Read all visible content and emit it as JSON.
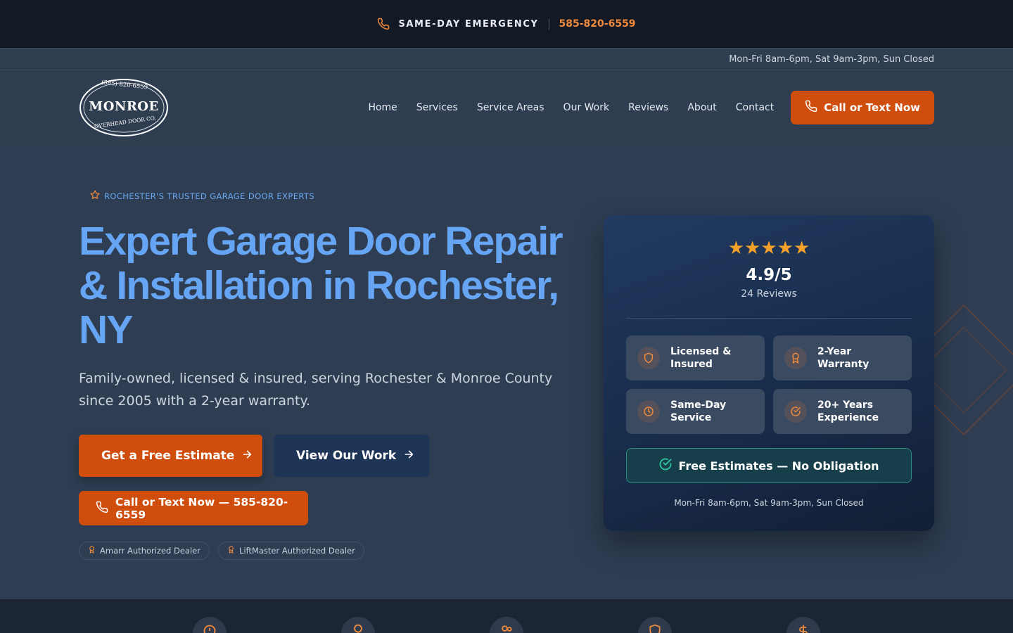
{
  "topbar": {
    "emergency_label": "SAME-DAY EMERGENCY",
    "phone": "585-820-6559"
  },
  "hours_bar": {
    "text": "Mon-Fri 8am-6pm, Sat 9am-3pm, Sun Closed"
  },
  "logo": {
    "phone": "(585) 820-6559",
    "name": "MONROE",
    "subtitle": "OVERHEAD DOOR CO."
  },
  "nav": {
    "items": [
      {
        "label": "Home"
      },
      {
        "label": "Services"
      },
      {
        "label": "Service Areas"
      },
      {
        "label": "Our Work"
      },
      {
        "label": "Reviews"
      },
      {
        "label": "About"
      },
      {
        "label": "Contact"
      }
    ],
    "cta_label": "Call or Text Now"
  },
  "hero": {
    "eyebrow": "ROCHESTER'S TRUSTED GARAGE DOOR EXPERTS",
    "headline": "Expert Garage Door Repair & Installation in Rochester, NY",
    "lead": "Family-owned, licensed & insured, serving Rochester & Monroe County since 2005 with a 2-year warranty.",
    "btn_estimate": "Get a Free Estimate",
    "btn_work": "View Our Work",
    "btn_call": "Call or Text Now — 585-820-6559",
    "dealers": [
      "Amarr Authorized Dealer",
      "LiftMaster Authorized Dealer"
    ]
  },
  "card": {
    "stars": "★★★★★",
    "rating": "4.9/5",
    "review_count": "24 Reviews",
    "features": [
      {
        "label": "Licensed & Insured",
        "icon": "shield-icon"
      },
      {
        "label": "2-Year Warranty",
        "icon": "award-icon"
      },
      {
        "label": "Same-Day Service",
        "icon": "clock-icon"
      },
      {
        "label": "20+ Years Experience",
        "icon": "check-circle-icon"
      }
    ],
    "free_estimate": "Free Estimates — No Obligation",
    "hours": "Mon-Fri 8am-6pm, Sat 9am-3pm, Sun Closed"
  },
  "colors": {
    "accent_orange": "#cf4e0e",
    "headline_blue": "#66a5f3",
    "star_gold": "#f4a12a",
    "teal": "#2ec4a0"
  }
}
